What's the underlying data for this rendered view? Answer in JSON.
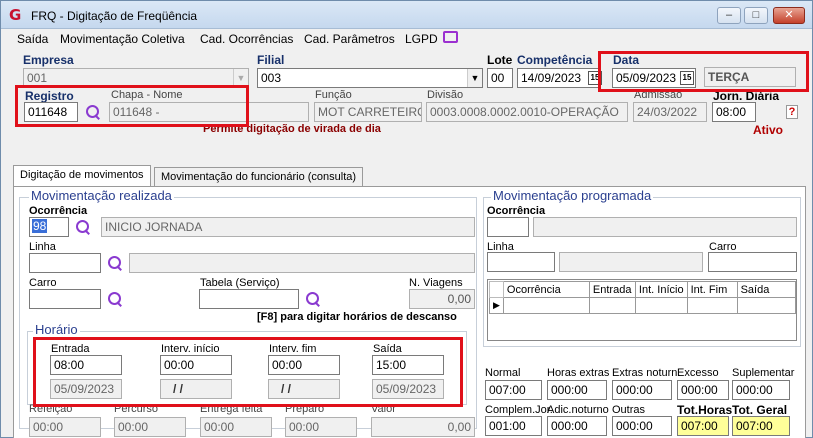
{
  "window": {
    "title": "FRQ - Digitação de Freqüência",
    "app_icon": "G"
  },
  "menu": [
    "Saída",
    "Movimentação Coletiva",
    "Cad. Ocorrências",
    "Cad. Parâmetros",
    "LGPD"
  ],
  "header": {
    "empresa_label": "Empresa",
    "empresa_value": "001",
    "filial_label": "Filial",
    "filial_value": "003",
    "lote_label": "Lote",
    "lote_value": "00",
    "competencia_label": "Competência",
    "competencia_value": "14/09/2023",
    "data_label": "Data",
    "data_value": "05/09/2023",
    "weekday": "TERÇA",
    "registro_label": "Registro",
    "registro_value": "011648",
    "chapa_label": "Chapa - Nome",
    "chapa_value": "011648 -",
    "funcao_label": "Função",
    "funcao_value": "MOT CARRETEIRO",
    "divisao_label": "Divisão",
    "divisao_value": "0003.0008.0002.0010-OPERAÇÃO",
    "admissao_label": "Admissão",
    "admissao_value": "24/03/2022",
    "jorn_label": "Jorn. Diária",
    "jorn_value": "08:00",
    "help_label": "?",
    "virada_msg": "Permite digitação de virada de dia",
    "status": "Ativo",
    "cal_icon": "15"
  },
  "tabs": [
    "Digitação de movimentos",
    "Movimentação do funcionário (consulta)"
  ],
  "realizada": {
    "title": "Movimentação realizada",
    "ocorrencia_label": "Ocorrência",
    "ocorrencia_code": "98",
    "ocorrencia_desc": "INICIO JORNADA",
    "linha_label": "Linha",
    "carro_label": "Carro",
    "tabela_label": "Tabela (Serviço)",
    "nviagens_label": "N. Viagens",
    "nviagens_value": "0,00",
    "f8_hint": "[F8] para digitar horários de descanso",
    "horario_title": "Horário",
    "entrada_label": "Entrada",
    "entrada_value": "08:00",
    "entrada_date": "05/09/2023",
    "interv_ini_label": "Interv. início",
    "interv_ini_value": "00:00",
    "interv_ini_date": "/ /",
    "interv_fim_label": "Interv. fim",
    "interv_fim_value": "00:00",
    "interv_fim_date": "/ /",
    "saida_label": "Saída",
    "saida_value": "15:00",
    "saida_date": "05/09/2023",
    "bottom_labels": [
      "Refeição",
      "Percurso",
      "Entrega feita",
      "Preparo",
      "Valor"
    ],
    "bottom_values": [
      "00:00",
      "00:00",
      "00:00",
      "00:00",
      "0,00"
    ]
  },
  "programada": {
    "title": "Movimentação programada",
    "ocorrencia_label": "Ocorrência",
    "linha_label": "Linha",
    "carro_label": "Carro",
    "grid_headers": [
      "Ocorrência",
      "Entrada",
      "Int. Início",
      "Int. Fim",
      "Saída"
    ],
    "totals_row1_labels": [
      "Normal",
      "Horas extras",
      "Extras noturn.",
      "Excesso",
      "Suplementar"
    ],
    "totals_row1_values": [
      "007:00",
      "000:00",
      "000:00",
      "000:00",
      "000:00"
    ],
    "totals_row2_labels": [
      "Complem.Jor.",
      "Adic.noturno",
      "Outras",
      "Tot.Horas",
      "Tot. Geral"
    ],
    "totals_row2_values": [
      "001:00",
      "000:00",
      "000:00",
      "007:00",
      "007:00"
    ]
  },
  "colors": {
    "highlight_box": "#e0101a",
    "total_bg": "#ffff99",
    "label_blue": "#17306a"
  }
}
